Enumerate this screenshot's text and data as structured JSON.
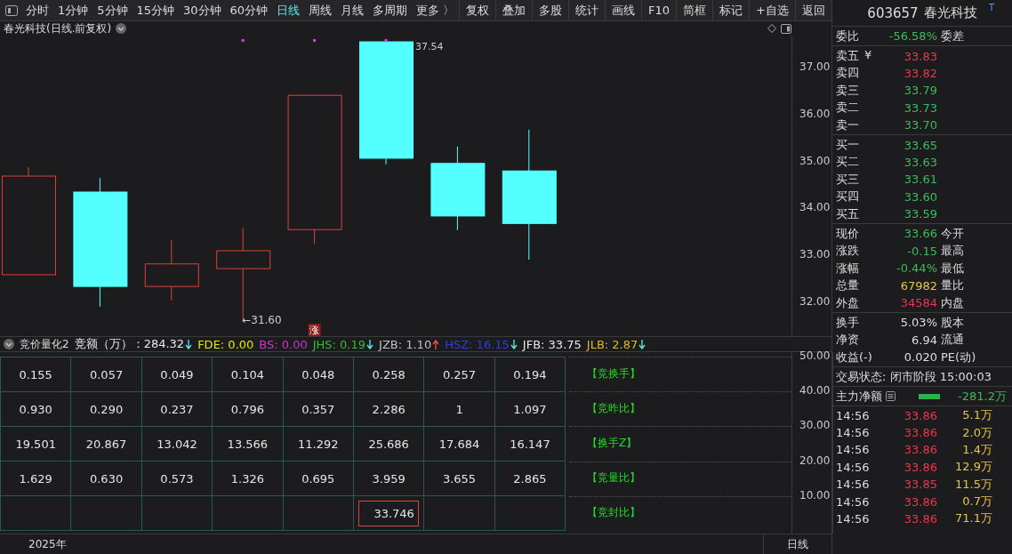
{
  "toolbar": {
    "periods": [
      {
        "label": "分时",
        "selected": false
      },
      {
        "label": "1分钟",
        "selected": false
      },
      {
        "label": "5分钟",
        "selected": false
      },
      {
        "label": "15分钟",
        "selected": false
      },
      {
        "label": "30分钟",
        "selected": false
      },
      {
        "label": "60分钟",
        "selected": false
      },
      {
        "label": "日线",
        "selected": true
      },
      {
        "label": "周线",
        "selected": false
      },
      {
        "label": "月线",
        "selected": false
      },
      {
        "label": "多周期",
        "selected": false
      },
      {
        "label": "更多 〉",
        "selected": false
      }
    ],
    "tools": [
      "复权",
      "叠加",
      "多股",
      "统计",
      "画线",
      "F10",
      "简框",
      "标记",
      "+自选",
      "返回"
    ]
  },
  "chart": {
    "title": "春光科技(日线.前复权)",
    "high_label": "37.54",
    "low_label": "←31.60",
    "price_ticks": [
      "37.00",
      "36.00",
      "35.00",
      "34.00",
      "33.00",
      "32.00"
    ],
    "signals": [
      {
        "marked": false
      },
      {
        "marked": false
      },
      {
        "marked": false
      },
      {
        "marked": true
      },
      {
        "marked": true,
        "badge": "涨"
      },
      {
        "marked": true
      },
      {
        "marked": false
      },
      {
        "marked": false
      }
    ]
  },
  "indicator": {
    "name": "竞价量化2",
    "readouts": [
      {
        "text": "竞额（万）：284.32",
        "color": "#e8e8e8",
        "kind": "falling"
      },
      {
        "text": "FDE: 0.00",
        "color": "#e6e600",
        "kind": "plain"
      },
      {
        "text": "BS: 0.00",
        "color": "#cc33cc",
        "kind": "plain"
      },
      {
        "text": "JHS: 0.19",
        "color": "#33bb33",
        "kind": "falling"
      },
      {
        "text": "JZB: 1.10",
        "color": "#c0c0c0",
        "kind": "rising"
      },
      {
        "text": "HSZ: 16.15",
        "color": "#2a3fe0",
        "kind": "falling"
      },
      {
        "text": "JFB: 33.75",
        "color": "#e8e8e8",
        "kind": "plain"
      },
      {
        "text": "JLB: 2.87",
        "color": "#ddbb22",
        "kind": "falling"
      }
    ],
    "rows": [
      {
        "label": "【竞换手】",
        "cells": [
          "0.155",
          "0.057",
          "0.049",
          "0.104",
          "0.048",
          "0.258",
          "0.257",
          "0.194"
        ]
      },
      {
        "label": "【竞昨比】",
        "cells": [
          "0.930",
          "0.290",
          "0.237",
          "0.796",
          "0.357",
          "2.286",
          "1",
          "1.097"
        ]
      },
      {
        "label": "【换手Z】",
        "cells": [
          "19.501",
          "20.867",
          "13.042",
          "13.566",
          "11.292",
          "25.686",
          "17.684",
          "16.147"
        ]
      },
      {
        "label": "【竞量比】",
        "cells": [
          "1.629",
          "0.630",
          "0.573",
          "1.326",
          "0.695",
          "3.959",
          "3.655",
          "2.865"
        ]
      },
      {
        "label": "【竞封比】",
        "cells": [
          null,
          null,
          null,
          null,
          null,
          {
            "text": "33.746",
            "boxed": true
          },
          null,
          null
        ]
      }
    ],
    "ticks": [
      "50.00",
      "40.00",
      "30.00",
      "20.00",
      "10.00"
    ],
    "year": "2025年",
    "period": "日线"
  },
  "quote": {
    "code": "603657",
    "name": "春光科技",
    "flag": "T",
    "bid_ratio": {
      "label": "委比",
      "value": "-56.58%",
      "color": "#3dbb5a",
      "label2": "委差"
    },
    "asks": [
      {
        "label": "卖五",
        "mark": "¥",
        "value": "33.83",
        "color": "#e8384f"
      },
      {
        "label": "卖四",
        "value": "33.82",
        "color": "#e8384f"
      },
      {
        "label": "卖三",
        "value": "33.79",
        "color": "#3dbb5a"
      },
      {
        "label": "卖二",
        "value": "33.73",
        "color": "#3dbb5a"
      },
      {
        "label": "卖一",
        "value": "33.70",
        "color": "#3dbb5a"
      }
    ],
    "bids": [
      {
        "label": "买一",
        "value": "33.65",
        "color": "#3dbb5a"
      },
      {
        "label": "买二",
        "value": "33.63",
        "color": "#3dbb5a"
      },
      {
        "label": "买三",
        "value": "33.61",
        "color": "#3dbb5a"
      },
      {
        "label": "买四",
        "value": "33.60",
        "color": "#3dbb5a"
      },
      {
        "label": "买五",
        "value": "33.59",
        "color": "#3dbb5a"
      }
    ],
    "stats": [
      {
        "label": "现价",
        "value": "33.66",
        "color": "#3dbb5a",
        "label2": "今开"
      },
      {
        "label": "涨跌",
        "value": "-0.15",
        "color": "#3dbb5a",
        "label2": "最高"
      },
      {
        "label": "涨幅",
        "value": "-0.44%",
        "color": "#3dbb5a",
        "label2": "最低"
      },
      {
        "label": "总量",
        "value": "67982",
        "color": "#e8c34a",
        "label2": "量比"
      },
      {
        "label": "外盘",
        "value": "34584",
        "color": "#e8384f",
        "label2": "内盘"
      }
    ],
    "fundamentals": [
      {
        "label": "换手",
        "value": "5.03%",
        "label2": "股本"
      },
      {
        "label": "净资",
        "value": "6.94",
        "label2": "流通"
      },
      {
        "label": "收益(-)",
        "value": "0.020",
        "label2": "PE(动)"
      }
    ],
    "status": "交易状态: 闭市阶段 15:00:03",
    "main_force": {
      "label": "主力净额",
      "value": "-281.2万"
    },
    "trades": [
      {
        "time": "14:56",
        "price": "33.86",
        "volume": "5.1万"
      },
      {
        "time": "14:56",
        "price": "33.86",
        "volume": "2.0万"
      },
      {
        "time": "14:56",
        "price": "33.86",
        "volume": "1.4万"
      },
      {
        "time": "14:56",
        "price": "33.86",
        "volume": "12.9万"
      },
      {
        "time": "14:56",
        "price": "33.85",
        "volume": "11.5万"
      },
      {
        "time": "14:56",
        "price": "33.86",
        "volume": "0.7万"
      },
      {
        "time": "14:56",
        "price": "33.86",
        "volume": "71.1万"
      }
    ]
  }
}
